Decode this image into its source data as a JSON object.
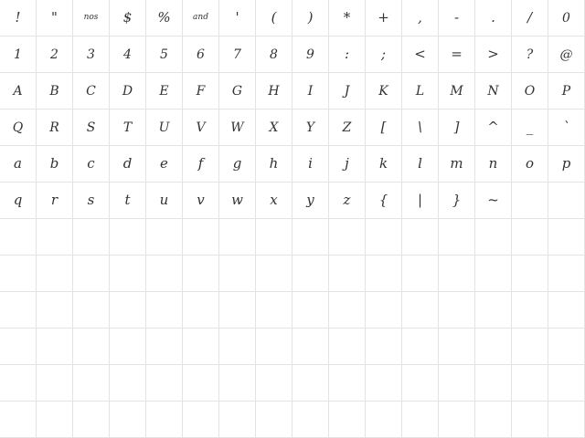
{
  "glyph_rows": [
    [
      "!",
      "\"",
      "nos",
      "$",
      "%",
      "and",
      "'",
      "(",
      ")",
      "*",
      "+",
      ",",
      "-",
      ".",
      "/",
      "0"
    ],
    [
      "1",
      "2",
      "3",
      "4",
      "5",
      "6",
      "7",
      "8",
      "9",
      ":",
      ";",
      "<",
      "=",
      ">",
      "?",
      "@"
    ],
    [
      "A",
      "B",
      "C",
      "D",
      "E",
      "F",
      "G",
      "H",
      "I",
      "J",
      "K",
      "L",
      "M",
      "N",
      "O",
      "P"
    ],
    [
      "Q",
      "R",
      "S",
      "T",
      "U",
      "V",
      "W",
      "X",
      "Y",
      "Z",
      "[",
      "\\",
      "]",
      "^",
      "_",
      "`"
    ],
    [
      "a",
      "b",
      "c",
      "d",
      "e",
      "f",
      "g",
      "h",
      "i",
      "j",
      "k",
      "l",
      "m",
      "n",
      "o",
      "p"
    ],
    [
      "q",
      "r",
      "s",
      "t",
      "u",
      "v",
      "w",
      "x",
      "y",
      "z",
      "{",
      "|",
      "}",
      "~"
    ]
  ],
  "decorated_glyphs": [
    "0",
    "1",
    "2",
    "3",
    "4",
    "5",
    "6",
    "7",
    "8",
    "9",
    "?",
    "@",
    "A",
    "B",
    "C",
    "D",
    "E",
    "F",
    "G",
    "H",
    "I",
    "J",
    "K",
    "L",
    "M",
    "N",
    "O",
    "P",
    "Q",
    "R",
    "S",
    "T",
    "U",
    "V",
    "W",
    "X",
    "Y",
    "Z"
  ],
  "colors": {
    "grid_line": "#e3e3e3",
    "glyph": "#333333",
    "background": "#ffffff"
  }
}
